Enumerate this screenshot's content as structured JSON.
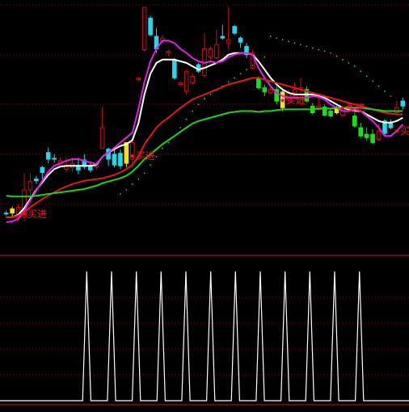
{
  "colors": {
    "background": "#000000",
    "grid": "#7a1010",
    "separator": "#c01818",
    "up_candle": "#d01010",
    "down_candle": "#20d8f0",
    "green_bar": "#18e018",
    "yellow_bar": "#f0e020",
    "ma_white": "#ffffff",
    "ma_magenta": "#e020e0",
    "ma_red": "#e01818",
    "ma_green": "#20d020",
    "signal_label": "#f01818",
    "indicator_line": "#ffffff"
  },
  "chart_data": [
    {
      "type": "candlestick",
      "title": "",
      "xlabel": "",
      "ylabel": "",
      "grid": true,
      "ylim": [
        0,
        300
      ],
      "candles": [
        {
          "o": 254,
          "c": 253,
          "h": 256,
          "l": 250,
          "kind": "down"
        },
        {
          "o": 253,
          "c": 248,
          "h": 258,
          "l": 245,
          "kind": "yellow"
        },
        {
          "o": 246,
          "c": 258,
          "h": 262,
          "l": 242,
          "kind": "up"
        },
        {
          "o": 258,
          "c": 225,
          "h": 262,
          "l": 205,
          "kind": "up"
        },
        {
          "o": 225,
          "c": 215,
          "h": 232,
          "l": 205,
          "kind": "up"
        },
        {
          "o": 214,
          "c": 212,
          "h": 218,
          "l": 208,
          "kind": "down"
        },
        {
          "o": 204,
          "c": 198,
          "h": 212,
          "l": 196,
          "kind": "down"
        },
        {
          "o": 180,
          "c": 188,
          "h": 193,
          "l": 174,
          "kind": "down"
        },
        {
          "o": 187,
          "c": 188,
          "h": 192,
          "l": 182,
          "kind": "down"
        },
        {
          "o": 190,
          "c": 195,
          "h": 198,
          "l": 186,
          "kind": "up"
        },
        {
          "o": 197,
          "c": 200,
          "h": 204,
          "l": 186,
          "kind": "up"
        },
        {
          "o": 198,
          "c": 193,
          "h": 203,
          "l": 186,
          "kind": "up"
        },
        {
          "o": 201,
          "c": 196,
          "h": 206,
          "l": 186,
          "kind": "down"
        },
        {
          "o": 189,
          "c": 197,
          "h": 200,
          "l": 182,
          "kind": "down"
        },
        {
          "o": 201,
          "c": 196,
          "h": 204,
          "l": 192,
          "kind": "down"
        },
        {
          "o": 197,
          "c": 193,
          "h": 200,
          "l": 190,
          "kind": "up"
        },
        {
          "o": 150,
          "c": 175,
          "h": 160,
          "l": 125,
          "kind": "up"
        },
        {
          "o": 176,
          "c": 188,
          "h": 196,
          "l": 174,
          "kind": "down"
        },
        {
          "o": 182,
          "c": 195,
          "h": 198,
          "l": 174,
          "kind": "down"
        },
        {
          "o": 181,
          "c": 196,
          "h": 200,
          "l": 176,
          "kind": "down"
        },
        {
          "o": 193,
          "c": 168,
          "h": 198,
          "l": 168,
          "kind": "yellow"
        },
        {
          "o": 188,
          "c": 168,
          "h": 198,
          "l": 165,
          "kind": "up"
        },
        {
          "o": 92,
          "c": 90,
          "h": 94,
          "l": 89,
          "kind": "up"
        },
        {
          "o": 56,
          "c": 5,
          "h": 58,
          "l": 5,
          "kind": "up"
        },
        {
          "o": 18,
          "c": 38,
          "h": 40,
          "l": 15,
          "kind": "down"
        },
        {
          "o": 40,
          "c": 55,
          "h": 60,
          "l": 30,
          "kind": "down"
        },
        {
          "o": 42,
          "c": 45,
          "h": 48,
          "l": 38,
          "kind": "up"
        },
        {
          "o": 60,
          "c": 58,
          "h": 64,
          "l": 56,
          "kind": "up"
        },
        {
          "o": 68,
          "c": 90,
          "h": 92,
          "l": 66,
          "kind": "down"
        },
        {
          "o": 96,
          "c": 98,
          "h": 100,
          "l": 94,
          "kind": "up"
        },
        {
          "o": 106,
          "c": 82,
          "h": 110,
          "l": 80,
          "kind": "up"
        },
        {
          "o": 88,
          "c": 96,
          "h": 98,
          "l": 84,
          "kind": "up"
        },
        {
          "o": 74,
          "c": 82,
          "h": 84,
          "l": 72,
          "kind": "down"
        },
        {
          "o": 87,
          "c": 55,
          "h": 90,
          "l": 36,
          "kind": "up"
        },
        {
          "o": 55,
          "c": 65,
          "h": 68,
          "l": 52,
          "kind": "up"
        },
        {
          "o": 66,
          "c": 50,
          "h": 68,
          "l": 32,
          "kind": "up"
        },
        {
          "o": 40,
          "c": 42,
          "h": 44,
          "l": 26,
          "kind": "down"
        },
        {
          "o": 44,
          "c": 48,
          "h": 56,
          "l": 5,
          "kind": "up"
        },
        {
          "o": 28,
          "c": 36,
          "h": 38,
          "l": 26,
          "kind": "down"
        },
        {
          "o": 42,
          "c": 47,
          "h": 54,
          "l": 40,
          "kind": "down"
        },
        {
          "o": 52,
          "c": 62,
          "h": 66,
          "l": 48,
          "kind": "down"
        },
        {
          "o": 60,
          "c": 78,
          "h": 80,
          "l": 56,
          "kind": "up"
        },
        {
          "o": 90,
          "c": 102,
          "h": 104,
          "l": 88,
          "kind": "green"
        },
        {
          "o": 102,
          "c": 107,
          "h": 112,
          "l": 98,
          "kind": "green"
        },
        {
          "o": 104,
          "c": 108,
          "h": 110,
          "l": 100,
          "kind": "up"
        },
        {
          "o": 104,
          "c": 118,
          "h": 122,
          "l": 100,
          "kind": "green"
        },
        {
          "o": 126,
          "c": 107,
          "h": 130,
          "l": 104,
          "kind": "yellow"
        },
        {
          "o": 108,
          "c": 116,
          "h": 120,
          "l": 104,
          "kind": "up"
        },
        {
          "o": 108,
          "c": 104,
          "h": 112,
          "l": 96,
          "kind": "up"
        },
        {
          "o": 104,
          "c": 102,
          "h": 108,
          "l": 90,
          "kind": "up"
        },
        {
          "o": 104,
          "c": 118,
          "h": 120,
          "l": 100,
          "kind": "green"
        },
        {
          "o": 124,
          "c": 132,
          "h": 134,
          "l": 120,
          "kind": "green"
        },
        {
          "o": 124,
          "c": 128,
          "h": 130,
          "l": 112,
          "kind": "up"
        },
        {
          "o": 125,
          "c": 135,
          "h": 136,
          "l": 122,
          "kind": "green"
        },
        {
          "o": 130,
          "c": 136,
          "h": 138,
          "l": 128,
          "kind": "green"
        },
        {
          "o": 127,
          "c": 132,
          "h": 134,
          "l": 124,
          "kind": "yellow"
        },
        {
          "o": 127,
          "c": 135,
          "h": 138,
          "l": 124,
          "kind": "up"
        },
        {
          "o": 124,
          "c": 130,
          "h": 132,
          "l": 122,
          "kind": "up"
        },
        {
          "o": 136,
          "c": 148,
          "h": 150,
          "l": 132,
          "kind": "green"
        },
        {
          "o": 150,
          "c": 160,
          "h": 162,
          "l": 144,
          "kind": "green"
        },
        {
          "o": 158,
          "c": 162,
          "h": 166,
          "l": 150,
          "kind": "green"
        },
        {
          "o": 158,
          "c": 168,
          "h": 170,
          "l": 152,
          "kind": "green"
        },
        {
          "o": 154,
          "c": 164,
          "h": 166,
          "l": 146,
          "kind": "up"
        },
        {
          "o": 142,
          "c": 157,
          "h": 160,
          "l": 140,
          "kind": "down"
        },
        {
          "o": 144,
          "c": 150,
          "h": 152,
          "l": 140,
          "kind": "down"
        },
        {
          "o": 126,
          "c": 132,
          "h": 134,
          "l": 118,
          "kind": "up"
        },
        {
          "o": 118,
          "c": 124,
          "h": 128,
          "l": 114,
          "kind": "down"
        }
      ],
      "moving_averages": [
        {
          "color": "ma_white",
          "values": [
            258,
            258,
            255,
            247,
            236,
            225,
            216,
            207,
            200,
            197,
            196,
            196,
            196,
            196,
            196,
            195,
            185,
            180,
            176,
            172,
            170,
            165,
            145,
            110,
            85,
            72,
            68,
            68,
            68,
            70,
            72,
            76,
            80,
            78,
            75,
            72,
            68,
            62,
            60,
            60,
            60,
            62,
            70,
            80,
            90,
            98,
            104,
            108,
            110,
            110,
            110,
            110,
            112,
            114,
            118,
            122,
            126,
            128,
            130,
            130,
            134,
            138,
            142,
            144,
            144,
            142,
            138
          ]
        },
        {
          "color": "ma_magenta",
          "values": [
            264,
            263,
            260,
            250,
            238,
            226,
            214,
            203,
            196,
            193,
            190,
            188,
            188,
            190,
            192,
            194,
            185,
            180,
            174,
            168,
            162,
            156,
            128,
            95,
            70,
            55,
            45,
            45,
            48,
            55,
            60,
            66,
            70,
            72,
            70,
            72,
            70,
            65,
            62,
            60,
            60,
            62,
            78,
            90,
            100,
            108,
            112,
            114,
            114,
            114,
            114,
            112,
            113,
            116,
            122,
            126,
            130,
            130,
            128,
            130,
            136,
            142,
            150,
            160,
            160,
            154,
            146
          ]
        },
        {
          "color": "ma_red",
          "values": [
            258,
            258,
            256,
            252,
            246,
            241,
            236,
            232,
            228,
            224,
            221,
            218,
            216,
            214,
            213,
            212,
            211,
            209,
            207,
            204,
            200,
            195,
            185,
            170,
            160,
            150,
            143,
            138,
            132,
            126,
            121,
            116,
            113,
            110,
            107,
            104,
            101,
            98,
            96,
            94,
            92,
            90,
            90,
            92,
            94,
            96,
            98,
            100,
            102,
            104,
            106,
            108,
            110,
            112,
            114,
            116,
            118,
            120,
            122,
            124,
            126,
            128,
            130,
            132,
            133,
            134,
            134
          ]
        },
        {
          "color": "ma_green",
          "values": [
            232,
            233,
            233,
            233,
            233,
            232,
            231,
            230,
            229,
            228,
            227,
            226,
            225,
            224,
            222,
            220,
            217,
            215,
            213,
            211,
            208,
            203,
            196,
            188,
            182,
            176,
            170,
            165,
            160,
            155,
            150,
            145,
            142,
            140,
            138,
            136,
            134,
            132,
            131,
            130,
            130,
            130,
            131,
            130,
            130,
            129,
            128,
            128,
            128,
            128,
            128,
            128,
            127,
            127,
            127,
            126,
            126,
            126,
            126,
            126,
            127,
            128,
            129,
            130,
            130,
            130,
            130
          ]
        }
      ],
      "dots": [
        {
          "i": 19,
          "v": 230
        },
        {
          "i": 20,
          "v": 225
        },
        {
          "i": 21,
          "v": 218
        },
        {
          "i": 22,
          "v": 212
        },
        {
          "i": 23,
          "v": 205
        },
        {
          "i": 24,
          "v": 195
        },
        {
          "i": 25,
          "v": 185
        },
        {
          "i": 26,
          "v": 175
        },
        {
          "i": 27,
          "v": 168
        },
        {
          "i": 28,
          "v": 160
        },
        {
          "i": 29,
          "v": 150
        },
        {
          "i": 30,
          "v": 140
        },
        {
          "i": 31,
          "v": 130
        },
        {
          "i": 32,
          "v": 122
        },
        {
          "i": 33,
          "v": 115
        },
        {
          "i": 34,
          "v": 110
        },
        {
          "i": 35,
          "v": 105
        },
        {
          "i": 36,
          "v": 100
        },
        {
          "i": 37,
          "v": 95
        },
        {
          "i": 38,
          "v": 90
        },
        {
          "i": 39,
          "v": 85
        },
        {
          "i": 40,
          "v": 80
        },
        {
          "i": 41,
          "v": 75
        },
        {
          "i": 42,
          "v": 70
        },
        {
          "i": 43,
          "v": 65
        },
        {
          "i": 44,
          "v": 40
        },
        {
          "i": 45,
          "v": 42
        },
        {
          "i": 46,
          "v": 44
        },
        {
          "i": 47,
          "v": 46
        },
        {
          "i": 48,
          "v": 48
        },
        {
          "i": 49,
          "v": 50
        },
        {
          "i": 50,
          "v": 52
        },
        {
          "i": 51,
          "v": 54
        },
        {
          "i": 52,
          "v": 56
        },
        {
          "i": 53,
          "v": 58
        },
        {
          "i": 54,
          "v": 60
        },
        {
          "i": 55,
          "v": 64
        },
        {
          "i": 56,
          "v": 68
        },
        {
          "i": 57,
          "v": 72
        },
        {
          "i": 58,
          "v": 76
        },
        {
          "i": 59,
          "v": 82
        },
        {
          "i": 60,
          "v": 88
        },
        {
          "i": 61,
          "v": 94
        },
        {
          "i": 62,
          "v": 100
        },
        {
          "i": 63,
          "v": 106
        },
        {
          "i": 64,
          "v": 112
        }
      ],
      "signals": [
        {
          "i": 3,
          "v": 258,
          "label": "买进"
        },
        {
          "i": 21,
          "v": 188,
          "label": "买进"
        },
        {
          "i": 46,
          "v": 121,
          "label": "买进"
        },
        {
          "i": 56,
          "v": 130,
          "label": "买进"
        },
        {
          "i": 65,
          "v": 158,
          "label": "买进"
        }
      ]
    },
    {
      "type": "line",
      "title": "",
      "xlabel": "",
      "ylabel": "",
      "grid": true,
      "ylim": [
        0,
        1
      ],
      "series": [
        {
          "values": [
            0,
            0,
            0,
            0,
            0,
            0,
            0,
            0,
            0,
            0,
            0,
            0,
            0,
            0,
            0,
            0,
            0,
            0,
            0,
            0,
            0,
            1,
            0,
            0,
            0,
            0,
            0,
            1,
            0,
            0,
            0,
            0,
            0,
            1,
            0,
            0,
            0,
            0,
            0,
            1,
            0,
            0,
            0,
            0,
            0,
            1,
            0,
            0,
            0,
            0,
            0,
            1,
            0,
            0,
            0,
            0,
            0,
            1,
            0,
            0,
            0,
            0,
            0,
            1,
            0,
            0,
            0,
            0,
            0,
            1,
            0,
            0,
            0,
            0,
            0,
            1,
            0,
            0,
            0,
            0,
            0,
            1,
            0,
            0,
            0,
            0,
            0,
            1,
            0,
            0,
            0,
            0,
            0,
            0,
            0,
            0,
            0,
            0,
            0,
            0
          ]
        }
      ]
    }
  ]
}
